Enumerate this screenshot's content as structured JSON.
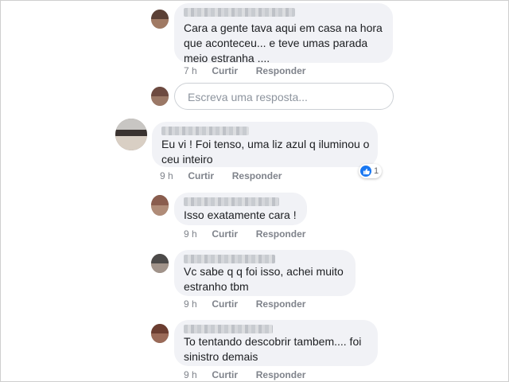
{
  "comments": [
    {
      "text": "Cara a gente tava aqui em casa na hora\nque aconteceu... e teve umas parada\nmeio estranha ....",
      "time": "7 h",
      "like_label": "Curtir",
      "reply_label": "Responder"
    },
    {
      "text": "Eu vi ! Foi tenso, uma liz azul q iluminou o\nceu inteiro",
      "time": "9 h",
      "like_label": "Curtir",
      "reply_label": "Responder",
      "reaction_count": "1"
    },
    {
      "text": "Isso exatamente cara !",
      "time": "9 h",
      "like_label": "Curtir",
      "reply_label": "Responder"
    },
    {
      "text": "Vc sabe q q foi isso, achei muito\nestranho tbm",
      "time": "9 h",
      "like_label": "Curtir",
      "reply_label": "Responder"
    },
    {
      "text": "To tentando descobrir tambem.... foi\nsinistro demais",
      "time": "9 h",
      "like_label": "Curtir",
      "reply_label": "Responder"
    }
  ],
  "reply_box": {
    "placeholder": "Escreva uma resposta..."
  },
  "icons": {
    "reaction": "like-icon"
  },
  "colors": {
    "bubble": "#f1f2f6",
    "like_blue": "#1877f2",
    "meta_text": "#7f838b"
  }
}
